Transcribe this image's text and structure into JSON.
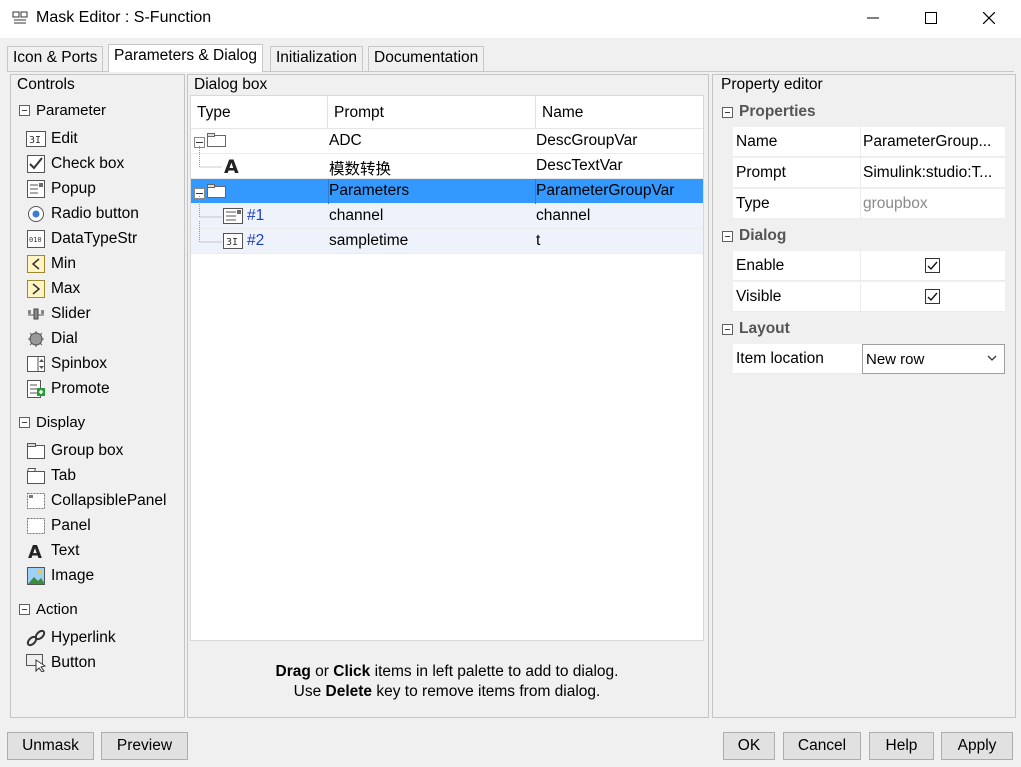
{
  "window": {
    "title": "Mask Editor : S-Function"
  },
  "tabs": [
    {
      "label": "Icon & Ports"
    },
    {
      "label": "Parameters & Dialog"
    },
    {
      "label": "Initialization"
    },
    {
      "label": "Documentation"
    }
  ],
  "controls": {
    "title": "Controls",
    "categories": [
      {
        "label": "Parameter"
      },
      {
        "label": "Display"
      },
      {
        "label": "Action"
      }
    ],
    "parameter_items": [
      {
        "label": "Edit"
      },
      {
        "label": "Check box"
      },
      {
        "label": "Popup"
      },
      {
        "label": "Radio button"
      },
      {
        "label": "DataTypeStr"
      },
      {
        "label": "Min"
      },
      {
        "label": "Max"
      },
      {
        "label": "Slider"
      },
      {
        "label": "Dial"
      },
      {
        "label": "Spinbox"
      },
      {
        "label": "Promote"
      }
    ],
    "display_items": [
      {
        "label": "Group box"
      },
      {
        "label": "Tab"
      },
      {
        "label": "CollapsiblePanel"
      },
      {
        "label": "Panel"
      },
      {
        "label": "Text"
      },
      {
        "label": "Image"
      }
    ],
    "action_items": [
      {
        "label": "Hyperlink"
      },
      {
        "label": "Button"
      }
    ]
  },
  "dialog_box": {
    "title": "Dialog box",
    "columns": [
      "Type",
      "Prompt",
      "Name"
    ],
    "rows": [
      {
        "type": "",
        "prompt": "ADC",
        "name": "DescGroupVar"
      },
      {
        "type": "",
        "prompt": "模数转换",
        "name": "DescTextVar"
      },
      {
        "type": "",
        "prompt": "Parameters",
        "name": "ParameterGroupVar"
      },
      {
        "type": "#1",
        "prompt": "channel",
        "name": "channel"
      },
      {
        "type": "#2",
        "prompt": "sampletime",
        "name": "t"
      }
    ],
    "hint": {
      "drag": "Drag",
      "or": " or ",
      "click": "Click",
      "line1_rest": " items in left palette to add to dialog.",
      "use": "Use ",
      "delete": "Delete",
      "line2_rest": " key to remove items from dialog."
    }
  },
  "property_editor": {
    "title": "Property editor",
    "sections": {
      "properties": "Properties",
      "dialog": "Dialog",
      "layout": "Layout"
    },
    "properties": [
      {
        "label": "Name",
        "value": "ParameterGroup..."
      },
      {
        "label": "Prompt",
        "value": "Simulink:studio:T..."
      },
      {
        "label": "Type",
        "value": "groupbox"
      }
    ],
    "dialog": [
      {
        "label": "Enable",
        "checked": true
      },
      {
        "label": "Visible",
        "checked": true
      }
    ],
    "layout": {
      "label": "Item location",
      "value": "New row"
    }
  },
  "buttons": {
    "unmask": "Unmask",
    "preview": "Preview",
    "ok": "OK",
    "cancel": "Cancel",
    "help": "Help",
    "apply": "Apply"
  },
  "colors": {
    "selection": "#3399ff",
    "hint_number": "#1f3fbf"
  }
}
